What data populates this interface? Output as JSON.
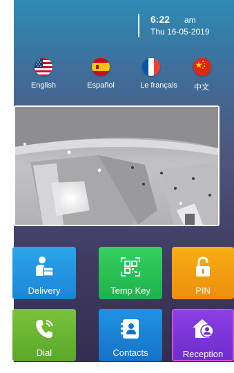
{
  "clock": {
    "time": "6:22",
    "ampm": "am",
    "date": "Thu 16-05-2019"
  },
  "languages": [
    {
      "label": "English",
      "icon": "us-flag-icon"
    },
    {
      "label": "Español",
      "icon": "spain-flag-icon"
    },
    {
      "label": "Le français",
      "icon": "france-flag-icon"
    },
    {
      "label": "中文",
      "icon": "china-flag-icon"
    }
  ],
  "camera": {
    "icon": "camera-feed"
  },
  "tiles": [
    {
      "label": "Delivery",
      "icon": "delivery-person-icon",
      "color": "#2196e6"
    },
    {
      "label": "Temp Key",
      "icon": "qr-code-icon",
      "color": "#27c255"
    },
    {
      "label": "PIN",
      "icon": "unlock-icon",
      "color": "#f2a010"
    },
    {
      "label": "Dial",
      "icon": "phone-icon",
      "color": "#6cb634"
    },
    {
      "label": "Contacts",
      "icon": "contacts-book-icon",
      "color": "#1a82d6"
    },
    {
      "label": "Reception",
      "icon": "reception-house-icon",
      "color": "#7b35d8"
    }
  ]
}
